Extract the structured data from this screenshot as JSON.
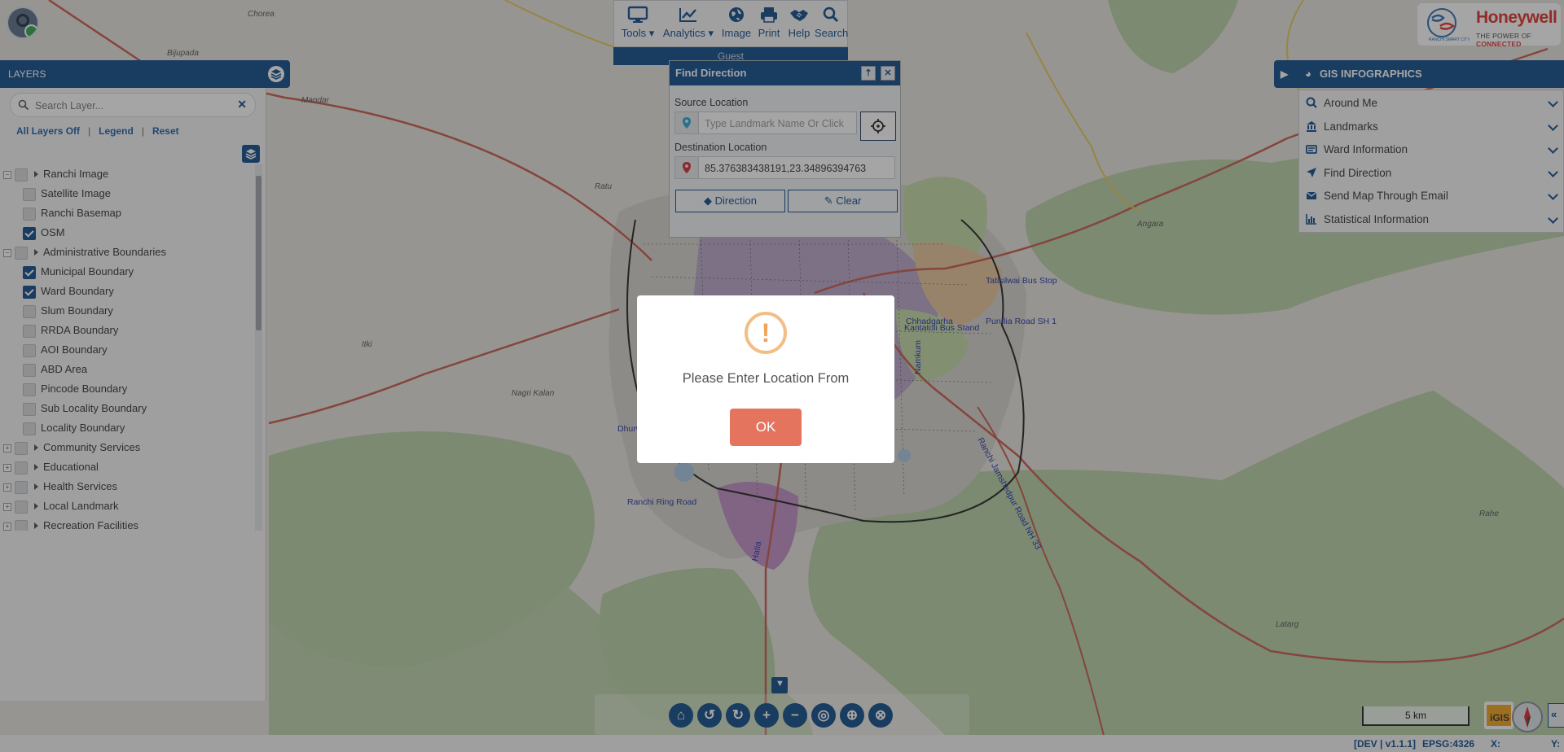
{
  "map": {
    "place_labels": [
      "Chorea",
      "Bijupada",
      "Mandar",
      "Ratu",
      "Angara",
      "Itki",
      "Nagri Kalan",
      "Rahe",
      "Latarg",
      "Chhadgarha",
      "Tatisilwai Bus Stop",
      "Kantatoli Bus Stand",
      "Purulia Road SH 1",
      "Ranchi Ring Road",
      "Ranchi Jamshedpur Road NH 33",
      "Namkum",
      "Dhurwa",
      "Hatia"
    ],
    "colors": {
      "land": "#e7e3dc",
      "forest": "#b7cfa4",
      "road": "#c85b4c",
      "water": "#aac7e3"
    }
  },
  "layers_panel": {
    "title": "LAYERS",
    "search_placeholder": "Search Layer...",
    "links": [
      "All Layers Off",
      "Legend",
      "Reset"
    ],
    "tree": [
      {
        "label": "Ranchi Image",
        "type": "group",
        "expanded": true
      },
      {
        "label": "Satellite Image",
        "type": "layer",
        "checked": false
      },
      {
        "label": "Ranchi Basemap",
        "type": "layer",
        "checked": false
      },
      {
        "label": "OSM",
        "type": "layer",
        "checked": true
      },
      {
        "label": "Administrative Boundaries",
        "type": "group",
        "expanded": true
      },
      {
        "label": "Municipal Boundary",
        "type": "layer",
        "checked": true
      },
      {
        "label": "Ward Boundary",
        "type": "layer",
        "checked": true
      },
      {
        "label": "Slum Boundary",
        "type": "layer",
        "checked": false
      },
      {
        "label": "RRDA Boundary",
        "type": "layer",
        "checked": false
      },
      {
        "label": "AOI Boundary",
        "type": "layer",
        "checked": false
      },
      {
        "label": "ABD Area",
        "type": "layer",
        "checked": false
      },
      {
        "label": "Pincode Boundary",
        "type": "layer",
        "checked": false
      },
      {
        "label": "Sub Locality Boundary",
        "type": "layer",
        "checked": false
      },
      {
        "label": "Locality Boundary",
        "type": "layer",
        "checked": false
      },
      {
        "label": "Community Services",
        "type": "group",
        "expanded": false
      },
      {
        "label": "Educational",
        "type": "group",
        "expanded": false
      },
      {
        "label": "Health Services",
        "type": "group",
        "expanded": false
      },
      {
        "label": "Local Landmark",
        "type": "group",
        "expanded": false
      },
      {
        "label": "Recreation Facilities",
        "type": "group",
        "expanded": false
      }
    ]
  },
  "toolbar": {
    "items": [
      {
        "label": "Tools",
        "icon": "monitor-icon",
        "dropdown": true
      },
      {
        "label": "Analytics",
        "icon": "line-chart-icon",
        "dropdown": true
      },
      {
        "label": "Image",
        "icon": "globe-icon",
        "dropdown": false
      },
      {
        "label": "Print",
        "icon": "printer-icon",
        "dropdown": false
      },
      {
        "label": "Help",
        "icon": "handshake-icon",
        "dropdown": false
      },
      {
        "label": "Search",
        "icon": "search-icon",
        "dropdown": false
      }
    ],
    "user_label": "Guest"
  },
  "find_direction": {
    "title": "Find Direction",
    "source_label": "Source Location",
    "source_placeholder": "Type Landmark Name Or Click",
    "source_value": "",
    "destination_label": "Destination Location",
    "destination_value": "85.376383438191,23.34896394763",
    "direction_button": "Direction",
    "clear_button": "Clear"
  },
  "gis_panel": {
    "title": "GIS INFOGRAPHICS",
    "items": [
      {
        "label": "Around Me",
        "icon": "search-location-icon"
      },
      {
        "label": "Landmarks",
        "icon": "landmark-icon"
      },
      {
        "label": "Ward Information",
        "icon": "ward-icon"
      },
      {
        "label": "Find Direction",
        "icon": "location-arrow-icon"
      },
      {
        "label": "Send Map Through Email",
        "icon": "envelope-icon"
      },
      {
        "label": "Statistical Information",
        "icon": "bar-chart-icon"
      }
    ]
  },
  "logo": {
    "brand": "Honeywell",
    "tagline_prefix": "THE POWER OF",
    "tagline_highlight": "CONNECTED"
  },
  "scale_bar": "5 km",
  "status_bar": {
    "version": "[DEV | v1.1.1]",
    "projection": "EPSG:4326",
    "x_label": "X:",
    "y_label": "Y:"
  },
  "alert": {
    "message": "Please Enter Location From",
    "ok_label": "OK",
    "icon": "!"
  }
}
